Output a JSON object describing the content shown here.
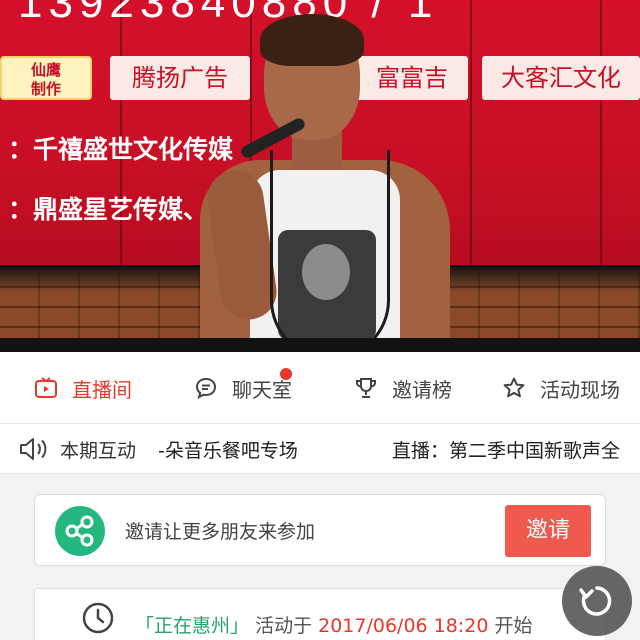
{
  "video": {
    "phone_text": "13923840880 / 1",
    "sponsor_logo_line1": "仙鹰",
    "sponsor_logo_line2": "制作",
    "sponsor_boxes": [
      "腾扬广告",
      "富富吉",
      "大客汇文化"
    ],
    "board_line1": "：千禧盛世文化传媒",
    "board_line2": "：鼎盛星艺传媒、                    乐部、九洲玉带湾"
  },
  "tabs": [
    {
      "label": "直播间",
      "icon": "live-tv-icon",
      "active": true
    },
    {
      "label": "聊天室",
      "icon": "chat-bubble-icon",
      "active": false,
      "badge": true
    },
    {
      "label": "邀请榜",
      "icon": "trophy-icon",
      "active": false
    },
    {
      "label": "活动现场",
      "icon": "star-icon",
      "active": false
    }
  ],
  "ticker": {
    "label": "本期互动",
    "items": [
      "-朵音乐餐吧专场",
      "直播：第二季中国新歌声全"
    ]
  },
  "invite": {
    "text": "邀请让更多朋友来参加",
    "button": "邀请"
  },
  "event": {
    "location": "「正在惠州」",
    "prefix": "活动于",
    "datetime": "2017/06/06 18:20",
    "suffix": "开始"
  },
  "colors": {
    "accent": "#e8382c",
    "invite_button": "#f05a4e",
    "share_green": "#25b77f",
    "location_green": "#2aa36b"
  }
}
